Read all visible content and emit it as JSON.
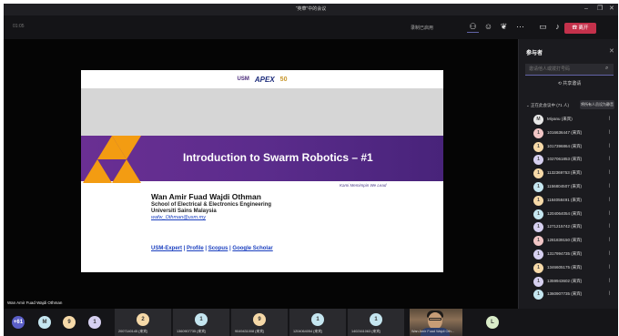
{
  "window": {
    "title": "\"英華\"中的会议"
  },
  "toolbar": {
    "timer": "01:05",
    "recording": "录制已启用",
    "icons": [
      "people-icon",
      "chat-icon",
      "reactions-icon",
      "more-icon",
      "camera-icon",
      "mic-icon",
      "share-icon"
    ],
    "leave_label": "离开"
  },
  "slide": {
    "logos": {
      "usm": "USM",
      "apex": "APEX",
      "anniversary": "50"
    },
    "title": "Introduction to Swarm Robotics – #1",
    "tagline": "Kami Memimpin  We Lead",
    "presenter_name": "Wan Amir Fuad Wajdi Othman",
    "school": "School of Electrical & Electronics Engineering",
    "university": "Universiti Sains Malaysia",
    "email": "wafw_Othman@usm.my",
    "links": [
      "USM-Expert",
      "Profile",
      "Scopus",
      "Google Scholar"
    ],
    "link_separator": " | "
  },
  "stage": {
    "presenter_label": "Wan Amir Fuad Wajdi Othman"
  },
  "panel": {
    "title": "参与者",
    "search_placeholder": "邀请他人或拨打号码",
    "share_label": "共享邀请",
    "section_label": "正在此会议中 (71 人)",
    "mute_all_label": "将所有人员设为静音",
    "participants": [
      {
        "initial": "M",
        "label": "Miyanu (来宾)",
        "color": "#e8e8e8"
      },
      {
        "initial": "1",
        "label": "1016636447 (来宾)",
        "color": "#f1c6c6"
      },
      {
        "initial": "1",
        "label": "1017396864 (来宾)",
        "color": "#f6d9a8"
      },
      {
        "initial": "1",
        "label": "1027061853 (来宾)",
        "color": "#d6d0f0"
      },
      {
        "initial": "1",
        "label": "1132369753 (来宾)",
        "color": "#f6d9a8"
      },
      {
        "initial": "1",
        "label": "1156804507 (来宾)",
        "color": "#c5e6f0"
      },
      {
        "initial": "1",
        "label": "1184058491 (来宾)",
        "color": "#f6d9a8"
      },
      {
        "initial": "1",
        "label": "1204064054 (来宾)",
        "color": "#c5e6f0"
      },
      {
        "initial": "1",
        "label": "1271215742 (来宾)",
        "color": "#d6d0f0"
      },
      {
        "initial": "1",
        "label": "1281839150 (来宾)",
        "color": "#f1c6c6"
      },
      {
        "initial": "1",
        "label": "1317994735 (来宾)",
        "color": "#d6d0f0"
      },
      {
        "initial": "1",
        "label": "1346605175 (来宾)",
        "color": "#f6d9a8"
      },
      {
        "initial": "1",
        "label": "1359943602 (来宾)",
        "color": "#d6d0f0"
      },
      {
        "initial": "1",
        "label": "1360907735 (来宾)",
        "color": "#c5e6f0"
      }
    ]
  },
  "strip": {
    "overflow_label": "+61",
    "small_avatars": [
      {
        "initial": "M",
        "color": "#c5e6f0"
      },
      {
        "initial": "9",
        "color": "#f6d9a8"
      },
      {
        "initial": "1",
        "color": "#d6d0f0"
      }
    ],
    "tiles": [
      {
        "initial": "2",
        "color": "#f6d9a8",
        "label": "2007140145 (来宾)"
      },
      {
        "initial": "1",
        "color": "#c5e6f0",
        "label": "1360907735 (来宾)"
      },
      {
        "initial": "9",
        "color": "#f6d9a8",
        "label": "9049431008 (来宾)"
      },
      {
        "initial": "1",
        "color": "#c5e6f0",
        "label": "1204064054 (来宾)"
      },
      {
        "initial": "1",
        "color": "#c5e6f0",
        "label": "1402161063 (来宾)"
      }
    ],
    "video_label": "Wan Amir Fuad Wajdi Oth...",
    "last_avatar": {
      "initial": "L",
      "color": "#d9ecc8"
    }
  }
}
